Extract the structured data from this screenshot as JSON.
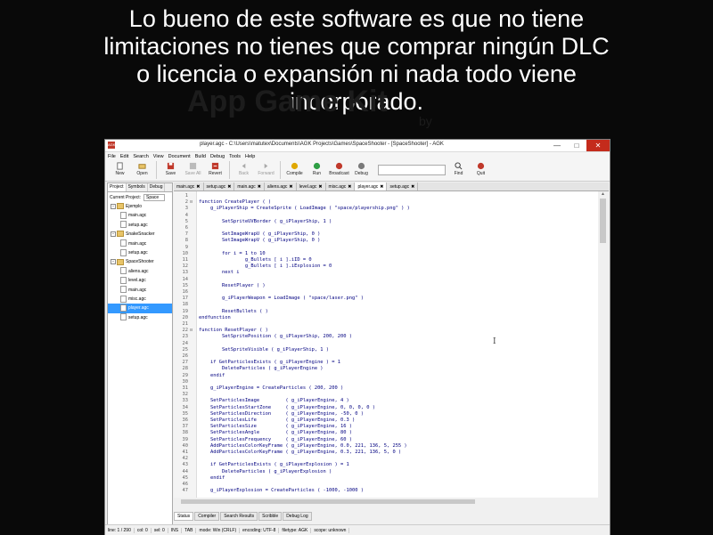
{
  "caption": {
    "lines": [
      "Lo bueno de este software es que no tiene",
      "limitaciones no tienes que comprar ningún DLC",
      "o licencia o expansión ni nada todo viene",
      "incorporado."
    ]
  },
  "watermark": {
    "text": "App Game Kit",
    "sub": "by"
  },
  "window": {
    "title": "player.agc - C:\\Users\\matutex\\Documents\\AGK Projects\\Games\\SpaceShooter - [SpaceShooter] - AGK",
    "icon_label": "AGK"
  },
  "menu": [
    "File",
    "Edit",
    "Search",
    "View",
    "Document",
    "Build",
    "Debug",
    "Tools",
    "Help"
  ],
  "toolbar": {
    "new": "New",
    "open": "Open",
    "save": "Save",
    "save_all": "Save All",
    "revert": "Revert",
    "back": "Back",
    "forward": "Forward",
    "compile": "Compile",
    "run": "Run",
    "broadcast": "Broadcast",
    "debug": "Debug",
    "find": "Find",
    "quit": "Quit",
    "search_value": ""
  },
  "left_panel": {
    "tabs": [
      "Project",
      "Symbols",
      "Debug"
    ],
    "current_project_label": "Current Project:",
    "current_project_value": "Space",
    "tree": [
      {
        "label": "Ejemplo",
        "type": "folder"
      },
      {
        "label": "main.agc",
        "type": "file"
      },
      {
        "label": "setup.agc",
        "type": "file"
      },
      {
        "label": "SnakeSnacker",
        "type": "folder"
      },
      {
        "label": "main.agc",
        "type": "file"
      },
      {
        "label": "setup.agc",
        "type": "file"
      },
      {
        "label": "SpaceShooter",
        "type": "folder"
      },
      {
        "label": "aliens.agc",
        "type": "file"
      },
      {
        "label": "level.agc",
        "type": "file"
      },
      {
        "label": "main.agc",
        "type": "file"
      },
      {
        "label": "misc.agc",
        "type": "file"
      },
      {
        "label": "player.agc",
        "type": "file",
        "selected": true
      },
      {
        "label": "setup.agc",
        "type": "file"
      }
    ]
  },
  "editor_tabs": [
    {
      "label": "main.agc",
      "close": "✖"
    },
    {
      "label": "setup.agc",
      "close": "✖"
    },
    {
      "label": "main.agc",
      "close": "✖"
    },
    {
      "label": "aliens.agc",
      "close": "✖"
    },
    {
      "label": "level.agc",
      "close": "✖"
    },
    {
      "label": "misc.agc",
      "close": "✖"
    },
    {
      "label": "player.agc",
      "close": "✖",
      "active": true
    },
    {
      "label": "setup.agc",
      "close": "✖"
    }
  ],
  "code_lines": [
    "",
    "function CreatePlayer ( )",
    "    g_iPlayerShip = CreateSprite ( LoadImage ( \"space/playership.png\" ) )",
    "",
    "        SetSpriteUVBorder ( g_iPlayerShip, 1 )",
    "",
    "        SetImageWrapU ( g_iPlayerShip, 0 )",
    "        SetImageWrapV ( g_iPlayerShip, 0 )",
    "",
    "        for i = 1 to 10",
    "                g_Bullets [ i ].iID = 0",
    "                g_Bullets [ i ].iExplosion = 0",
    "        next i",
    "",
    "        ResetPlayer ( )",
    "",
    "        g_iPlayerWeapon = LoadImage ( \"space/laser.png\" )",
    "",
    "        ResetBullets ( )",
    "endfunction",
    "",
    "function ResetPlayer ( )",
    "        SetSpritePosition ( g_iPlayerShip, 200, 200 )",
    "",
    "        SetSpriteVisible ( g_iPlayerShip, 1 )",
    "",
    "    if GetParticlesExists ( g_iPlayerEngine ) = 1",
    "        DeleteParticles ( g_iPlayerEngine )",
    "    endif",
    "",
    "    g_iPlayerEngine = CreateParticles ( 200, 200 )",
    "",
    "    SetParticlesImage         ( g_iPlayerEngine, 4 )",
    "    SetParticlesStartZone     ( g_iPlayerEngine, 0, 0, 0, 0 )",
    "    SetParticlesDirection     ( g_iPlayerEngine, -50, 0 )",
    "    SetParticlesLife          ( g_iPlayerEngine, 0.3 )",
    "    SetParticlesSize          ( g_iPlayerEngine, 16 )",
    "    SetParticlesAngle         ( g_iPlayerEngine, 80 )",
    "    SetParticlesFrequency     ( g_iPlayerEngine, 60 )",
    "    AddParticlesColorKeyFrame ( g_iPlayerEngine, 0.0, 221, 136, 5, 255 )",
    "    AddParticlesColorKeyFrame ( g_iPlayerEngine, 0.3, 221, 136, 5, 0 )",
    "",
    "    if GetParticlesExists ( g_iPlayerExplosion ) = 1",
    "        DeleteParticles ( g_iPlayerExplosion )",
    "    endif",
    "",
    "    g_iPlayerExplosion = CreateParticles ( -1000, -1000 )"
  ],
  "bottom_tabs": [
    "Status",
    "Compiler",
    "Search Results",
    "Scribble",
    "Debug Log"
  ],
  "status": [
    "line: 1 / 290",
    "col: 0",
    "sel: 0",
    "INS",
    "TAB",
    "mode: Win (CRLF)",
    "encoding: UTF-8",
    "filetype: AGK",
    "scope: unknown"
  ]
}
